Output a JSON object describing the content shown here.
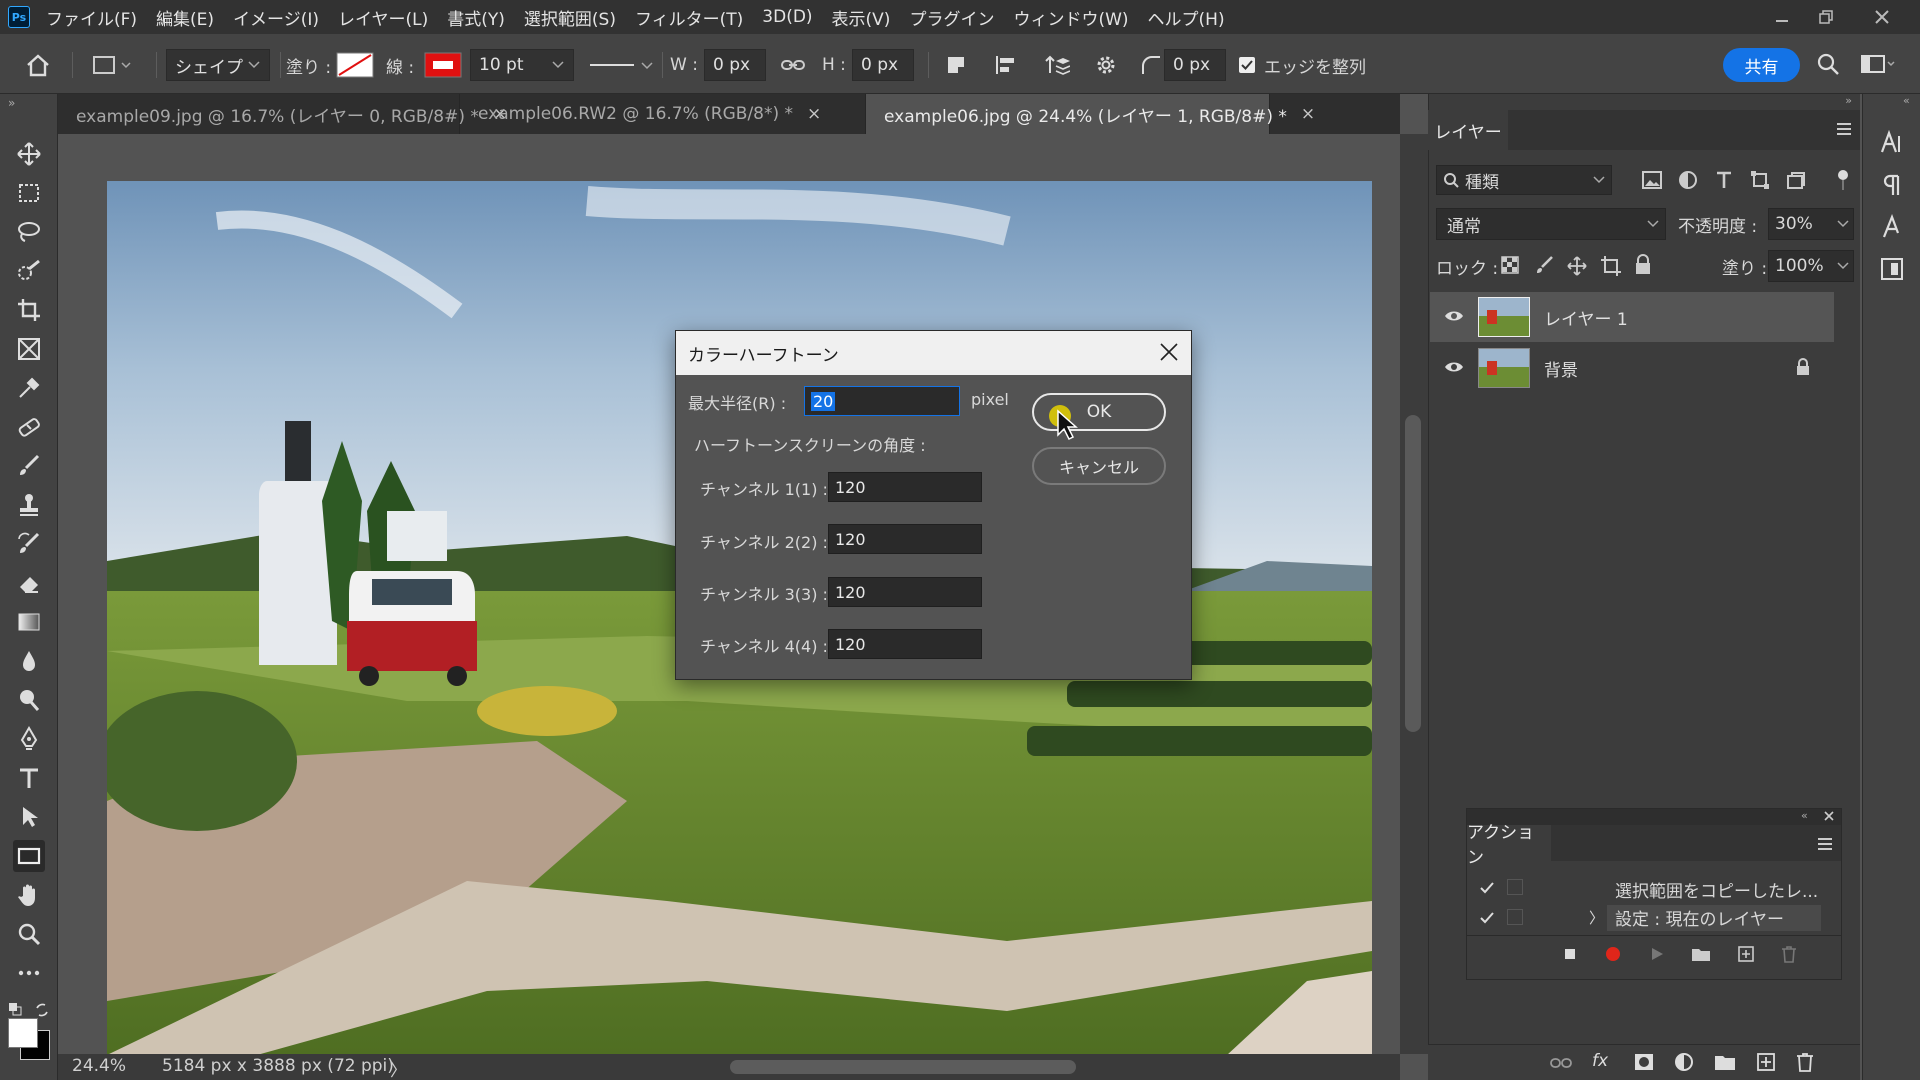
{
  "app": {
    "logo": "Ps"
  },
  "menubar": {
    "items": [
      "ファイル(F)",
      "編集(E)",
      "イメージ(I)",
      "レイヤー(L)",
      "書式(Y)",
      "選択範囲(S)",
      "フィルター(T)",
      "3D(D)",
      "表示(V)",
      "プラグイン",
      "ウィンドウ(W)",
      "ヘルプ(H)"
    ]
  },
  "options": {
    "shape_mode": "シェイプ",
    "fill_label": "塗り :",
    "stroke_label": "線 :",
    "stroke_width": "10 pt",
    "w_label": "W :",
    "w_value": "0 px",
    "h_label": "H :",
    "h_value": "0 px",
    "radius_value": "0 px",
    "align_edges": "エッジを整列",
    "share": "共有",
    "stroke_color": "#e01010"
  },
  "tabs": [
    {
      "label": "example09.jpg @ 16.7% (レイヤー 0, RGB/8#) *",
      "close": "×"
    },
    {
      "label": "example06.RW2 @ 16.7% (RGB/8*) *",
      "close": "×"
    },
    {
      "label": "example06.jpg @ 24.4% (レイヤー 1, RGB/8#) *",
      "close": "×"
    }
  ],
  "status": {
    "zoom": "24.4%",
    "doc_info": "5184 px x 3888 px (72 ppi)",
    "arrow": "〉"
  },
  "layers_panel": {
    "title": "レイヤー",
    "filter_kind": "種類",
    "blend_mode": "通常",
    "opacity_label": "不透明度 :",
    "opacity_value": "30%",
    "lock_label": "ロック :",
    "fill_label": "塗り :",
    "fill_value": "100%",
    "layers": [
      {
        "name": "レイヤー 1"
      },
      {
        "name": "背景"
      }
    ]
  },
  "actions_panel": {
    "title": "アクション",
    "items": [
      "選択範囲をコピーしたレ...",
      "設定 : 現在のレイヤー"
    ]
  },
  "dialog": {
    "title": "カラーハーフトーン",
    "max_radius_label": "最大半径(R) :",
    "max_radius_value": "20",
    "unit": "pixel",
    "angles_label": "ハーフトーンスクリーンの角度 :",
    "channels": [
      {
        "label": "チャンネル 1(1) :",
        "value": "120"
      },
      {
        "label": "チャンネル 2(2) :",
        "value": "120"
      },
      {
        "label": "チャンネル 3(3) :",
        "value": "120"
      },
      {
        "label": "チャンネル 4(4) :",
        "value": "120"
      }
    ],
    "ok": "OK",
    "cancel": "キャンセル",
    "close": "×"
  }
}
